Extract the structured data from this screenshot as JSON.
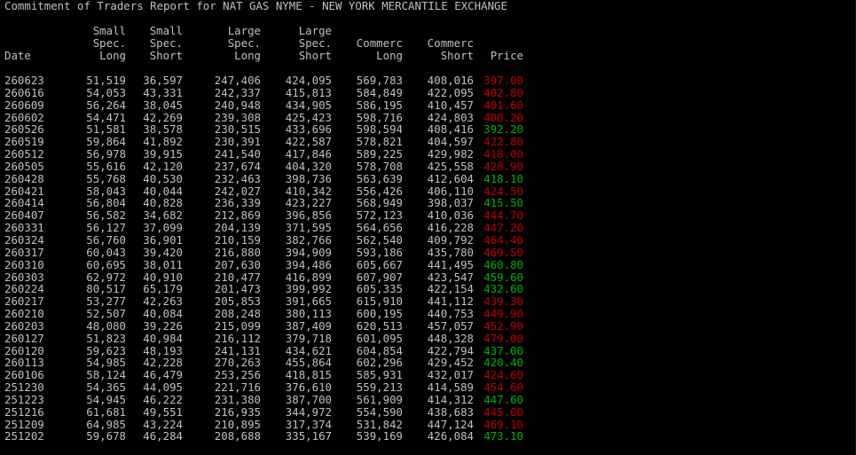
{
  "colors": {
    "background": "#000000",
    "text": "#c0c0c0",
    "price_up": "#00b000",
    "price_down": "#c00000"
  },
  "report": {
    "title": "Commitment of Traders Report for NAT GAS NYME - NEW YORK MERCANTILE EXCHANGE"
  },
  "header": {
    "line1": [
      "",
      "Small",
      "Small",
      "Large",
      "Large",
      "",
      "",
      ""
    ],
    "line2": [
      "",
      "Spec.",
      "Spec.",
      "Spec.",
      "Spec.",
      "Commerc",
      "Commerc",
      ""
    ],
    "line3": [
      "Date",
      "Long",
      "Short",
      "Long",
      "Short",
      "Long",
      "Short",
      "Price"
    ]
  },
  "rows": [
    {
      "date": "260623",
      "ssl": "51,519",
      "sss": "36,597",
      "lsl": "247,406",
      "lss": "424,095",
      "cl": "569,783",
      "cs": "408,016",
      "price": "397.00",
      "dir": "down"
    },
    {
      "date": "260616",
      "ssl": "54,053",
      "sss": "43,331",
      "lsl": "242,337",
      "lss": "415,813",
      "cl": "584,849",
      "cs": "422,095",
      "price": "402.80",
      "dir": "down"
    },
    {
      "date": "260609",
      "ssl": "56,264",
      "sss": "38,045",
      "lsl": "240,948",
      "lss": "434,905",
      "cl": "586,195",
      "cs": "410,457",
      "price": "401.60",
      "dir": "down"
    },
    {
      "date": "260602",
      "ssl": "54,471",
      "sss": "42,269",
      "lsl": "239,308",
      "lss": "425,423",
      "cl": "598,716",
      "cs": "424,803",
      "price": "408.20",
      "dir": "down"
    },
    {
      "date": "260526",
      "ssl": "51,581",
      "sss": "38,578",
      "lsl": "230,515",
      "lss": "433,696",
      "cl": "598,594",
      "cs": "408,416",
      "price": "392.20",
      "dir": "up"
    },
    {
      "date": "260519",
      "ssl": "59,864",
      "sss": "41,892",
      "lsl": "230,391",
      "lss": "422,587",
      "cl": "578,821",
      "cs": "404,597",
      "price": "422.80",
      "dir": "down"
    },
    {
      "date": "260512",
      "ssl": "56,978",
      "sss": "39,915",
      "lsl": "241,540",
      "lss": "417,846",
      "cl": "589,225",
      "cs": "429,982",
      "price": "418.00",
      "dir": "down"
    },
    {
      "date": "260505",
      "ssl": "55,616",
      "sss": "42,120",
      "lsl": "237,674",
      "lss": "404,320",
      "cl": "578,708",
      "cs": "425,558",
      "price": "428.90",
      "dir": "down"
    },
    {
      "date": "260428",
      "ssl": "55,768",
      "sss": "40,530",
      "lsl": "232,463",
      "lss": "398,736",
      "cl": "563,639",
      "cs": "412,604",
      "price": "418.10",
      "dir": "up"
    },
    {
      "date": "260421",
      "ssl": "58,043",
      "sss": "40,044",
      "lsl": "242,027",
      "lss": "410,342",
      "cl": "556,426",
      "cs": "406,110",
      "price": "424.50",
      "dir": "down"
    },
    {
      "date": "260414",
      "ssl": "56,804",
      "sss": "40,828",
      "lsl": "236,339",
      "lss": "423,227",
      "cl": "568,949",
      "cs": "398,037",
      "price": "415.50",
      "dir": "up"
    },
    {
      "date": "260407",
      "ssl": "56,582",
      "sss": "34,682",
      "lsl": "212,869",
      "lss": "396,856",
      "cl": "572,123",
      "cs": "410,036",
      "price": "444.70",
      "dir": "down"
    },
    {
      "date": "260331",
      "ssl": "56,127",
      "sss": "37,099",
      "lsl": "204,139",
      "lss": "371,595",
      "cl": "564,656",
      "cs": "416,228",
      "price": "447.20",
      "dir": "down"
    },
    {
      "date": "260324",
      "ssl": "56,760",
      "sss": "36,901",
      "lsl": "210,159",
      "lss": "382,766",
      "cl": "562,540",
      "cs": "409,792",
      "price": "464.40",
      "dir": "down"
    },
    {
      "date": "260317",
      "ssl": "60,043",
      "sss": "39,420",
      "lsl": "216,880",
      "lss": "394,909",
      "cl": "593,186",
      "cs": "435,780",
      "price": "469.50",
      "dir": "down"
    },
    {
      "date": "260310",
      "ssl": "60,695",
      "sss": "38,011",
      "lsl": "207,630",
      "lss": "394,486",
      "cl": "605,667",
      "cs": "441,495",
      "price": "460.80",
      "dir": "up"
    },
    {
      "date": "260303",
      "ssl": "62,972",
      "sss": "40,910",
      "lsl": "210,477",
      "lss": "416,899",
      "cl": "607,907",
      "cs": "423,547",
      "price": "459.60",
      "dir": "up"
    },
    {
      "date": "260224",
      "ssl": "80,517",
      "sss": "65,179",
      "lsl": "201,473",
      "lss": "399,992",
      "cl": "605,335",
      "cs": "422,154",
      "price": "432.60",
      "dir": "up"
    },
    {
      "date": "260217",
      "ssl": "53,277",
      "sss": "42,263",
      "lsl": "205,853",
      "lss": "391,665",
      "cl": "615,910",
      "cs": "441,112",
      "price": "439.30",
      "dir": "down"
    },
    {
      "date": "260210",
      "ssl": "52,507",
      "sss": "40,084",
      "lsl": "208,248",
      "lss": "380,113",
      "cl": "600,195",
      "cs": "440,753",
      "price": "449.90",
      "dir": "down"
    },
    {
      "date": "260203",
      "ssl": "48,080",
      "sss": "39,226",
      "lsl": "215,099",
      "lss": "387,409",
      "cl": "620,513",
      "cs": "457,057",
      "price": "452.90",
      "dir": "down"
    },
    {
      "date": "260127",
      "ssl": "51,823",
      "sss": "40,984",
      "lsl": "216,112",
      "lss": "379,718",
      "cl": "601,095",
      "cs": "448,328",
      "price": "479.00",
      "dir": "down"
    },
    {
      "date": "260120",
      "ssl": "59,623",
      "sss": "48,193",
      "lsl": "241,131",
      "lss": "434,621",
      "cl": "604,854",
      "cs": "422,794",
      "price": "437.00",
      "dir": "up"
    },
    {
      "date": "260113",
      "ssl": "54,985",
      "sss": "42,228",
      "lsl": "270,263",
      "lss": "455,864",
      "cl": "602,296",
      "cs": "429,452",
      "price": "420.40",
      "dir": "up"
    },
    {
      "date": "260106",
      "ssl": "58,124",
      "sss": "46,479",
      "lsl": "253,256",
      "lss": "418,815",
      "cl": "585,931",
      "cs": "432,017",
      "price": "424.60",
      "dir": "down"
    },
    {
      "date": "251230",
      "ssl": "54,365",
      "sss": "44,095",
      "lsl": "221,716",
      "lss": "376,610",
      "cl": "559,213",
      "cs": "414,589",
      "price": "454.60",
      "dir": "down"
    },
    {
      "date": "251223",
      "ssl": "54,945",
      "sss": "46,222",
      "lsl": "231,380",
      "lss": "387,700",
      "cl": "561,909",
      "cs": "414,312",
      "price": "447.60",
      "dir": "up"
    },
    {
      "date": "251216",
      "ssl": "61,681",
      "sss": "49,551",
      "lsl": "216,935",
      "lss": "344,972",
      "cl": "554,590",
      "cs": "438,683",
      "price": "445.00",
      "dir": "down"
    },
    {
      "date": "251209",
      "ssl": "64,985",
      "sss": "43,224",
      "lsl": "210,895",
      "lss": "317,374",
      "cl": "531,842",
      "cs": "447,124",
      "price": "469.10",
      "dir": "down"
    },
    {
      "date": "251202",
      "ssl": "59,678",
      "sss": "46,284",
      "lsl": "208,688",
      "lss": "335,167",
      "cl": "539,169",
      "cs": "426,084",
      "price": "473.10",
      "dir": "up"
    }
  ]
}
